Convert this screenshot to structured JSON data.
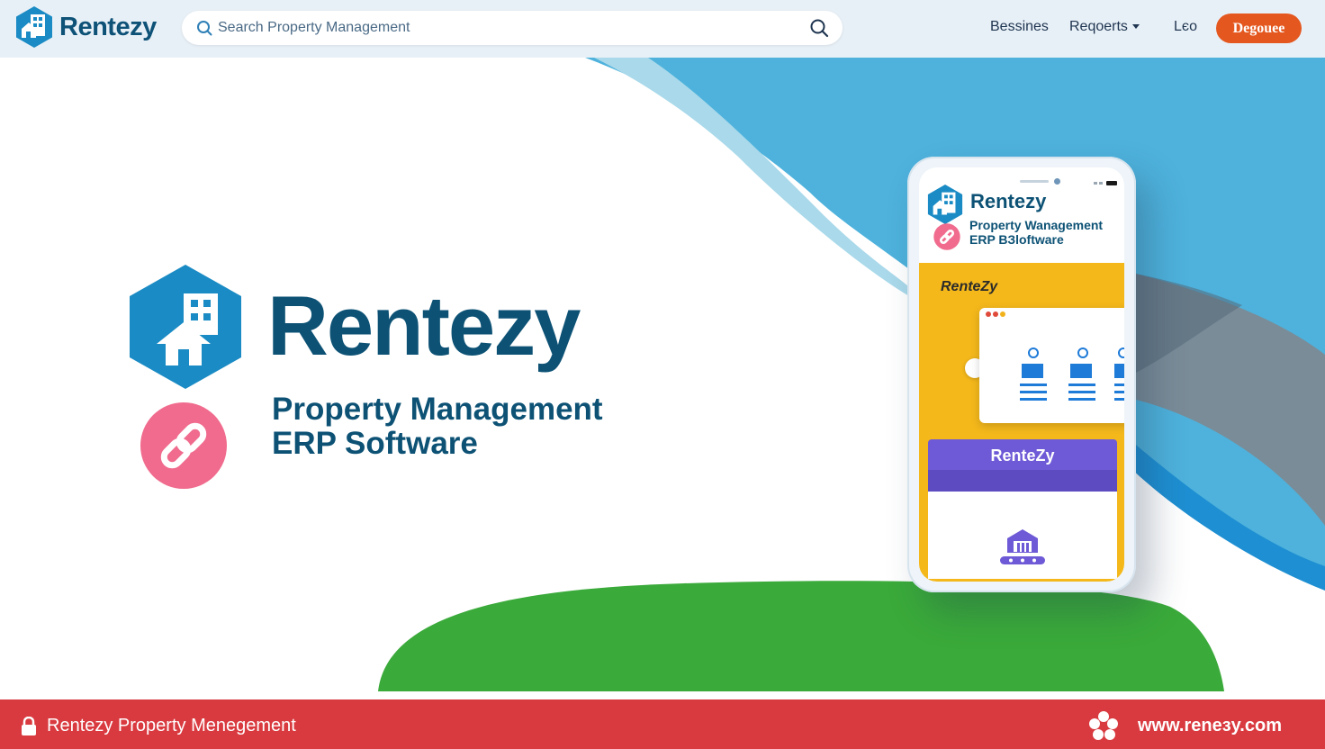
{
  "header": {
    "brand": "Rentezy",
    "search_placeholder": "Search Property Management",
    "nav": {
      "business": "Bessines",
      "reports": "Reqoerts",
      "login": "Lєo",
      "cta": "Degouee"
    }
  },
  "hero": {
    "title": "Rentezy",
    "subtitle_line1": "Property Management",
    "subtitle_line2": "ERP Software"
  },
  "phone": {
    "brand": "Rentezy",
    "subtitle_line1": "Property Wanagement",
    "subtitle_line2": "ERP ВЗloftware",
    "yellow_brand": "RenteZy",
    "banner": "RenteZy"
  },
  "footer": {
    "left_text": "Rentezy Property Menegement",
    "url": "www.reneзy.com"
  },
  "colors": {
    "brand_navy": "#0d5275",
    "brand_blue": "#1a8bc4",
    "cta_orange": "#e4571e",
    "footer_red": "#d93a3f",
    "accent_pink": "#f06b8d",
    "grass_green": "#3aaa3a",
    "phone_yellow": "#f4b81b",
    "phone_purple": "#6e5ad6"
  },
  "icons": {
    "brand_logo": "building-house-hexagon-icon",
    "search": "search-icon",
    "link": "link-icon",
    "footer_left": "lock-icon",
    "footer_right": "cluster-icon"
  }
}
